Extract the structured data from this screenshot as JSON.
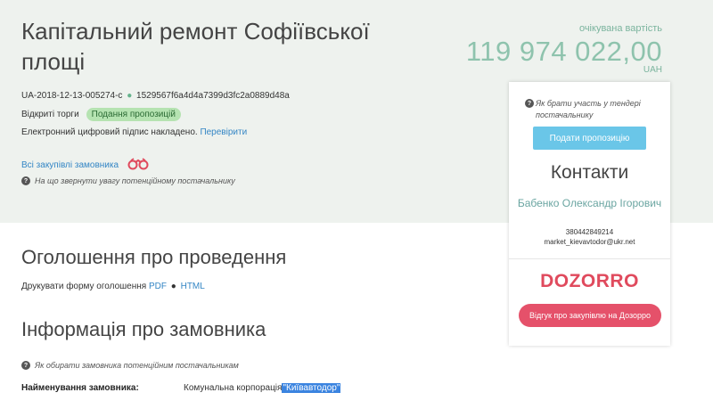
{
  "tender": {
    "title": "Капітальний ремонт Софіївської площі",
    "expected_cost_label": "очікувана вартість",
    "expected_cost_value": "119 974 022,00",
    "currency": "UAH",
    "id": "UA-2018-12-13-005274-c",
    "id_separator": "●",
    "hash": "1529567f6a4d4a7399d3fc2a0889d48a",
    "procedure": "Відкриті торги",
    "status_badge": "Подання пропозицій",
    "signature_text": "Електронний цифровий підпис накладено.",
    "verify_link": "Перевірити",
    "all_purchases_link": "Всі закупівлі замовника",
    "supplier_tip": "На що звернути увагу потенційному постачальнику"
  },
  "announcement": {
    "heading": "Оголошення про проведення",
    "print_text": "Друкувати форму оголошення",
    "pdf_link": "PDF",
    "separator": "●",
    "html_link": "HTML"
  },
  "customer": {
    "heading": "Інформація про замовника",
    "tip": "Як обирати замовника потенційним постачальникам",
    "name_label": "Найменування замовника:",
    "name_prefix": "Комунальна корпорація",
    "name_highlight": "\"Київавтодор\""
  },
  "panel": {
    "tip": "Як брати участь у тендері постачальнику",
    "submit_button": "Подати пропозицію",
    "contacts_title": "Контакти",
    "contact_name": "Бабенко Олександр Ігорович",
    "phone": "380442849214",
    "email": "market_kievavtodor@ukr.net",
    "dozorro_logo": "DOZORRO",
    "dozorro_button": "Відгук про закупівлю на Дозорро"
  },
  "colors": {
    "hero_bg": "#eef2ee",
    "accent_green": "#8ec3ad",
    "link_blue": "#3486c5",
    "submit_blue": "#6ac6e8",
    "dozorro_red": "#e5516a"
  }
}
